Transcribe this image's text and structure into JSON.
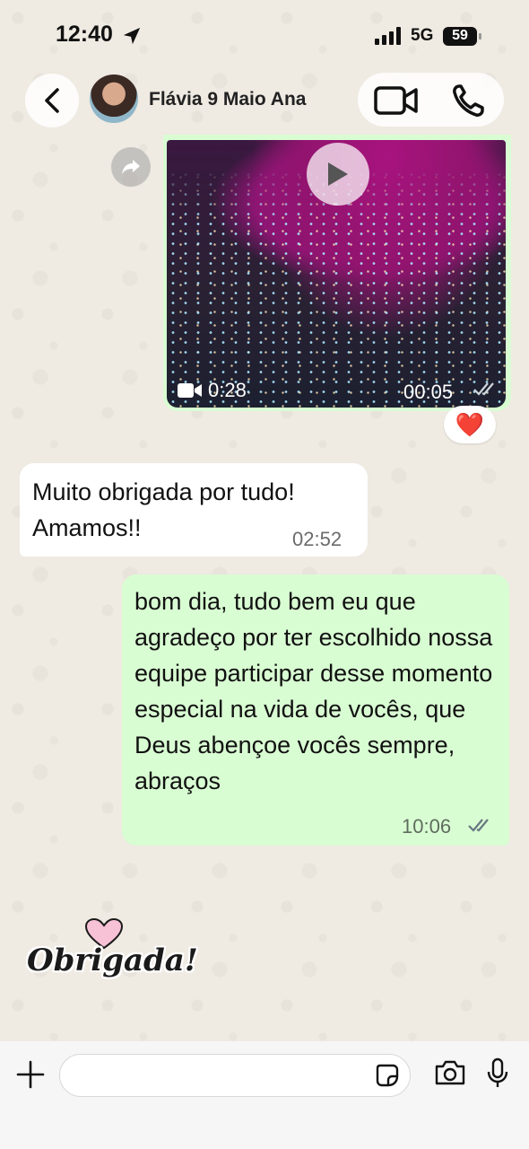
{
  "status_bar": {
    "time": "12:40",
    "network": "5G",
    "battery": "59"
  },
  "header": {
    "contact_name": "Flávia 9 Maio Ana"
  },
  "video_message": {
    "duration": "0:28",
    "time": "00:05",
    "reaction": "❤️"
  },
  "incoming_message": {
    "text": "Muito obrigada por tudo! Amamos!!",
    "time": "02:52"
  },
  "outgoing_message": {
    "text": "bom dia, tudo bem eu que agradeço por ter escolhido nossa equipe participar desse momento especial na vida de vocês, que Deus abençoe vocês sempre, abraços",
    "time": "10:06"
  },
  "sticker": {
    "text": "Obrigada!"
  },
  "input": {
    "placeholder": ""
  },
  "colors": {
    "outgoing_bubble": "#d9fdd3",
    "incoming_bubble": "#ffffff",
    "background": "#efeae2",
    "read_ticks": "#667781"
  }
}
